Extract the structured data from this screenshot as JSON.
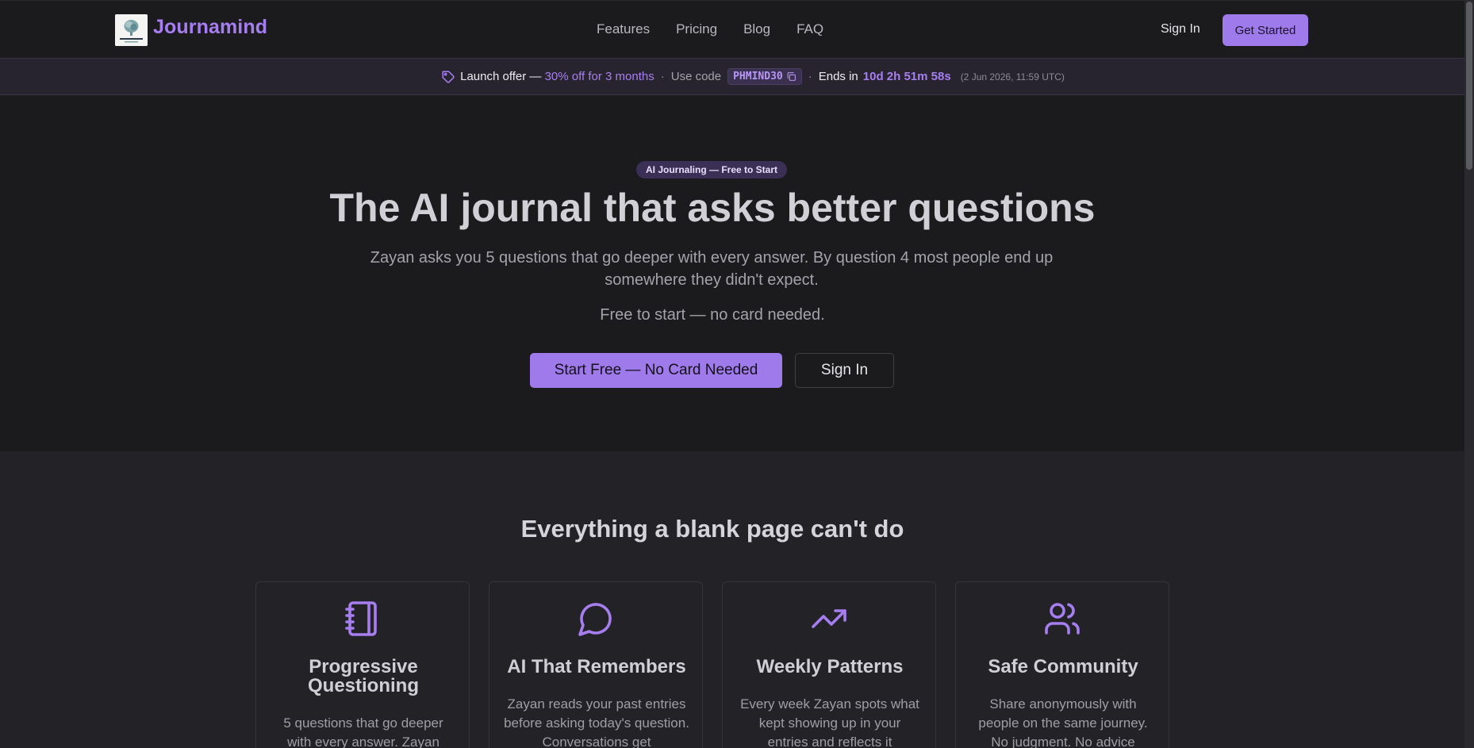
{
  "nav": {
    "brand": "Journamind",
    "links": [
      "Features",
      "Pricing",
      "Blog",
      "FAQ"
    ],
    "sign_in": "Sign In",
    "cta": "Get Started"
  },
  "promo": {
    "offer_label": "Launch offer —",
    "offer_value": "30% off for 3 months",
    "dot": "·",
    "use_code": "Use code",
    "code": "PHMIND30",
    "ends_in": "Ends in",
    "timer": "10d 2h 51m 58s",
    "date": "(2 Jun 2026, 11:59 UTC)"
  },
  "hero": {
    "badge": "AI Journaling — Free to Start",
    "title": "The AI journal that asks better questions",
    "subtitle": "Zayan asks you 5 questions that go deeper with every answer. By question 4 most people end up somewhere they didn't expect.",
    "free_note": "Free to start — no card needed.",
    "primary_button": "Start Free — No Card Needed",
    "secondary_button": "Sign In"
  },
  "features": {
    "title": "Everything a blank page can't do",
    "cards": [
      {
        "icon": "notebook-icon",
        "title": "Progressive Questioning",
        "desc": "5 questions that go deeper with every answer. Zayan"
      },
      {
        "icon": "chat-bubble-icon",
        "title": "AI That Remembers",
        "desc": "Zayan reads your past entries before asking today's question. Conversations get"
      },
      {
        "icon": "trending-up-icon",
        "title": "Weekly Patterns",
        "desc": "Every week Zayan spots what kept showing up in your entries and reflects it"
      },
      {
        "icon": "users-icon",
        "title": "Safe Community",
        "desc": "Share anonymously with people on the same journey. No judgment. No advice"
      }
    ]
  },
  "colors": {
    "accent": "#9f7aea",
    "accent_text": "#a77ef0",
    "background": "#1b1b1e",
    "section_background": "#232327"
  }
}
